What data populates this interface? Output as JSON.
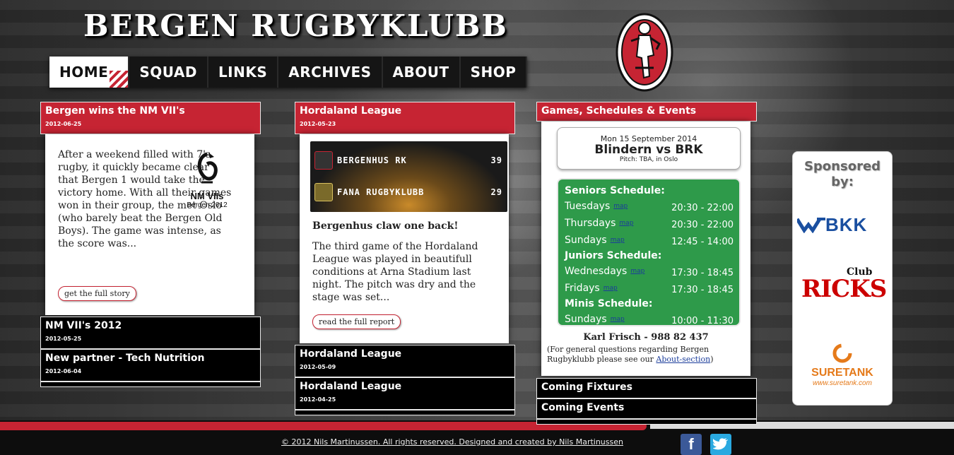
{
  "site": {
    "title": "BERGEN RUGBYKLUBB"
  },
  "nav": {
    "items": [
      "HOME",
      "SQUAD",
      "LINKS",
      "ARCHIVES",
      "ABOUT",
      "SHOP"
    ],
    "active": "HOME"
  },
  "news_col1": {
    "headline": "Bergen wins the NM VII's",
    "date": "2012-06-25",
    "body": "After a weekend filled with 7's rugby, it quickly became clear that Bergen 1 would take the victory home. With all their games won in their group, the met Oslo (who barely beat the Bergen Old Boys). The game was intense, as the score was...",
    "image_title": "NM VIIs",
    "image_subtitle": "Bergen 2012",
    "button": "get the full story",
    "older": [
      {
        "headline": "NM VII's 2012",
        "date": "2012-05-25"
      },
      {
        "headline": "New partner - Tech Nutrition",
        "date": "2012-06-04"
      }
    ]
  },
  "news_col2": {
    "headline": "Hordaland League",
    "date": "2012-05-23",
    "scoreboard": [
      {
        "team": "BERGENHUS RK",
        "score": "39"
      },
      {
        "team": "FANA RUGBYKLUBB",
        "score": "29"
      }
    ],
    "subheadline": "Bergenhus claw one back!",
    "body": "The third game of the Hordaland League was played in beautifull conditions at Arna Stadium last night. The pitch was dry and the stage was set...",
    "button": "read the full report",
    "older": [
      {
        "headline": "Hordaland League",
        "date": "2012-05-09"
      },
      {
        "headline": "Hordaland League",
        "date": "2012-04-25"
      }
    ]
  },
  "events": {
    "heading": "Games, Schedules & Events",
    "next_match": {
      "date": "Mon 15 September 2014",
      "title": "Blindern vs BRK",
      "pitch": "Pitch: TBA, in Oslo"
    },
    "schedules": [
      {
        "heading": "Seniors Schedule:",
        "rows": [
          {
            "day": "Tuesdays",
            "map": "map",
            "time": "20:30 - 22:00"
          },
          {
            "day": "Thursdays",
            "map": "map",
            "time": "20:30 - 22:00"
          },
          {
            "day": "Sundays",
            "map": "map",
            "time": "12:45 - 14:00"
          }
        ]
      },
      {
        "heading": "Juniors Schedule:",
        "rows": [
          {
            "day": "Wednesdays",
            "map": "map",
            "time": "17:30 - 18:45"
          },
          {
            "day": "Fridays",
            "map": "map",
            "time": "17:30 - 18:45"
          }
        ]
      },
      {
        "heading": "Minis Schedule:",
        "rows": [
          {
            "day": "Sundays",
            "map": "map",
            "time": "10:00 - 11:30"
          }
        ]
      }
    ],
    "contact_name": "Karl Frisch - 988 82 437",
    "contact_note_pre": "(For general questions regarding Bergen Rugbyklubb please see our ",
    "contact_link": "About-section",
    "contact_note_post": ")",
    "older": [
      {
        "headline": "Coming Fixtures"
      },
      {
        "headline": "Coming Events"
      }
    ]
  },
  "sponsors": {
    "heading": "Sponsored by:",
    "items": [
      {
        "name": "BKK"
      },
      {
        "name": "RICKS",
        "tag": "Club"
      },
      {
        "name": "SURETANK",
        "url_text": "www.suretank.com"
      }
    ]
  },
  "footer": {
    "copyright": "© 2012 Nils Martinussen. All rights reserved. Designed and created by Nils Martinussen",
    "social": [
      "facebook-icon",
      "twitter-icon"
    ]
  },
  "colors": {
    "accent_red": "#c62433",
    "schedule_green": "#2e9a4a",
    "bkk_blue": "#1a4fa0",
    "suretank_orange": "#e57a1a"
  }
}
